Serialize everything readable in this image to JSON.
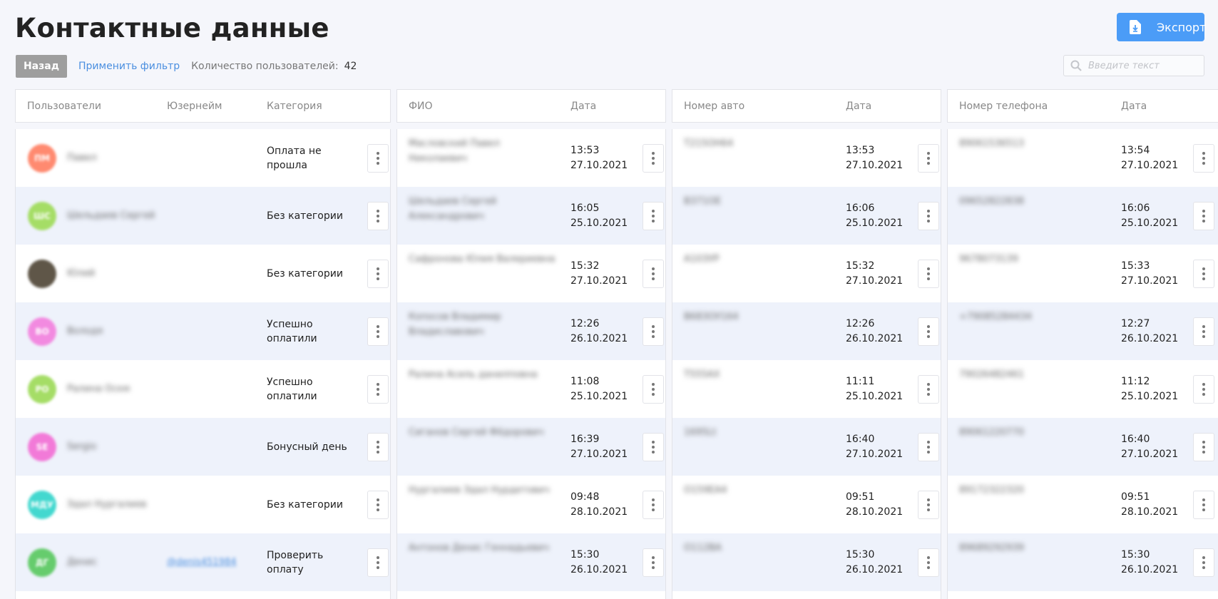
{
  "page": {
    "title": "Контактные данные"
  },
  "export": {
    "label": "Экспорт",
    "icon": "file-download-icon"
  },
  "toolbar": {
    "back_label": "Назад",
    "filter_label": "Применить фильтр",
    "count_label": "Количество пользователей:",
    "count_value": "42"
  },
  "search": {
    "placeholder": "Введите текст",
    "icon": "search-icon"
  },
  "users_panel": {
    "headers": [
      "Пользователи",
      "Юзернейм",
      "Категория"
    ],
    "rows": [
      {
        "initials": "ПМ",
        "color": "#ff8a70",
        "name": "Павел",
        "username": "",
        "category": "Оплата не прошла"
      },
      {
        "initials": "ШС",
        "color": "#a5dd66",
        "name": "Шельдаев Сергей",
        "username": "",
        "category": "Без категории"
      },
      {
        "initials": "",
        "color": "#5f5648",
        "name": "Юлий",
        "username": "",
        "category": "Без категории"
      },
      {
        "initials": "ВО",
        "color": "#f28ae0",
        "name": "Володя",
        "username": "",
        "category": "Успешно оплатили"
      },
      {
        "initials": "РО",
        "color": "#a5dd66",
        "name": "Ралина Оскм",
        "username": "",
        "category": "Успешно оплатили"
      },
      {
        "initials": "SE",
        "color": "#f27ad8",
        "name": "Sergio",
        "username": "",
        "category": "Бонусный день"
      },
      {
        "initials": "МДУ",
        "color": "#43d8cf",
        "name": "Эдал Нургалиев",
        "username": "",
        "category": "Без категории"
      },
      {
        "initials": "ДГ",
        "color": "#66cc6d",
        "name": "Денис",
        "username": "@denis451984",
        "category": "Проверить оплату"
      }
    ]
  },
  "fio_panel": {
    "headers": [
      "ФИО",
      "Дата"
    ],
    "rows": [
      {
        "value": "Масловский Павел Николаевич",
        "time": "13:53",
        "date": "27.10.2021"
      },
      {
        "value": "Шельдаев Сергей Александрович",
        "time": "16:05",
        "date": "25.10.2021"
      },
      {
        "value": "Сафронова Юлия Валериевна",
        "time": "15:32",
        "date": "27.10.2021"
      },
      {
        "value": "Копосов Владимир Владиславович",
        "time": "12:26",
        "date": "26.10.2021"
      },
      {
        "value": "Ралина Асиль данилповна",
        "time": "11:08",
        "date": "25.10.2021"
      },
      {
        "value": "Сиганов Сергей Фёдорович",
        "time": "16:39",
        "date": "27.10.2021"
      },
      {
        "value": "Нургалиев Эдал Нурдетович",
        "time": "09:48",
        "date": "28.10.2021"
      },
      {
        "value": "Антонов Денис Геннадьевич",
        "time": "15:30",
        "date": "26.10.2021"
      }
    ]
  },
  "car_panel": {
    "headers": [
      "Номер авто",
      "Дата"
    ],
    "rows": [
      {
        "value": "Т215ОН64",
        "time": "13:53",
        "date": "27.10.2021"
      },
      {
        "value": "В371ОЕ",
        "time": "16:06",
        "date": "25.10.2021"
      },
      {
        "value": "А103УР",
        "time": "15:32",
        "date": "27.10.2021"
      },
      {
        "value": "В683ОУ164",
        "time": "12:26",
        "date": "26.10.2021"
      },
      {
        "value": "Т555АХ",
        "time": "11:11",
        "date": "25.10.2021"
      },
      {
        "value": "1695Lt",
        "time": "16:40",
        "date": "27.10.2021"
      },
      {
        "value": "О159ЕА4",
        "time": "09:51",
        "date": "28.10.2021"
      },
      {
        "value": "О112ВА",
        "time": "15:30",
        "date": "26.10.2021"
      }
    ]
  },
  "phone_panel": {
    "headers": [
      "Номер телефона",
      "Дата"
    ],
    "rows": [
      {
        "value": "89061536513",
        "time": "13:54",
        "date": "27.10.2021"
      },
      {
        "value": "09652822838",
        "time": "16:06",
        "date": "25.10.2021"
      },
      {
        "value": "9678073139",
        "time": "15:33",
        "date": "27.10.2021"
      },
      {
        "value": "+79085284434",
        "time": "12:27",
        "date": "26.10.2021"
      },
      {
        "value": "79026482461",
        "time": "11:12",
        "date": "25.10.2021"
      },
      {
        "value": "89061220770",
        "time": "16:40",
        "date": "27.10.2021"
      },
      {
        "value": "89172322320",
        "time": "09:51",
        "date": "28.10.2021"
      },
      {
        "value": "89689292939",
        "time": "15:30",
        "date": "26.10.2021"
      }
    ]
  },
  "colors": {
    "accent": "#4b9cf7",
    "link": "#4b8fe0",
    "row_alt": "#eef2fb",
    "back_button": "#9e9e9e"
  }
}
